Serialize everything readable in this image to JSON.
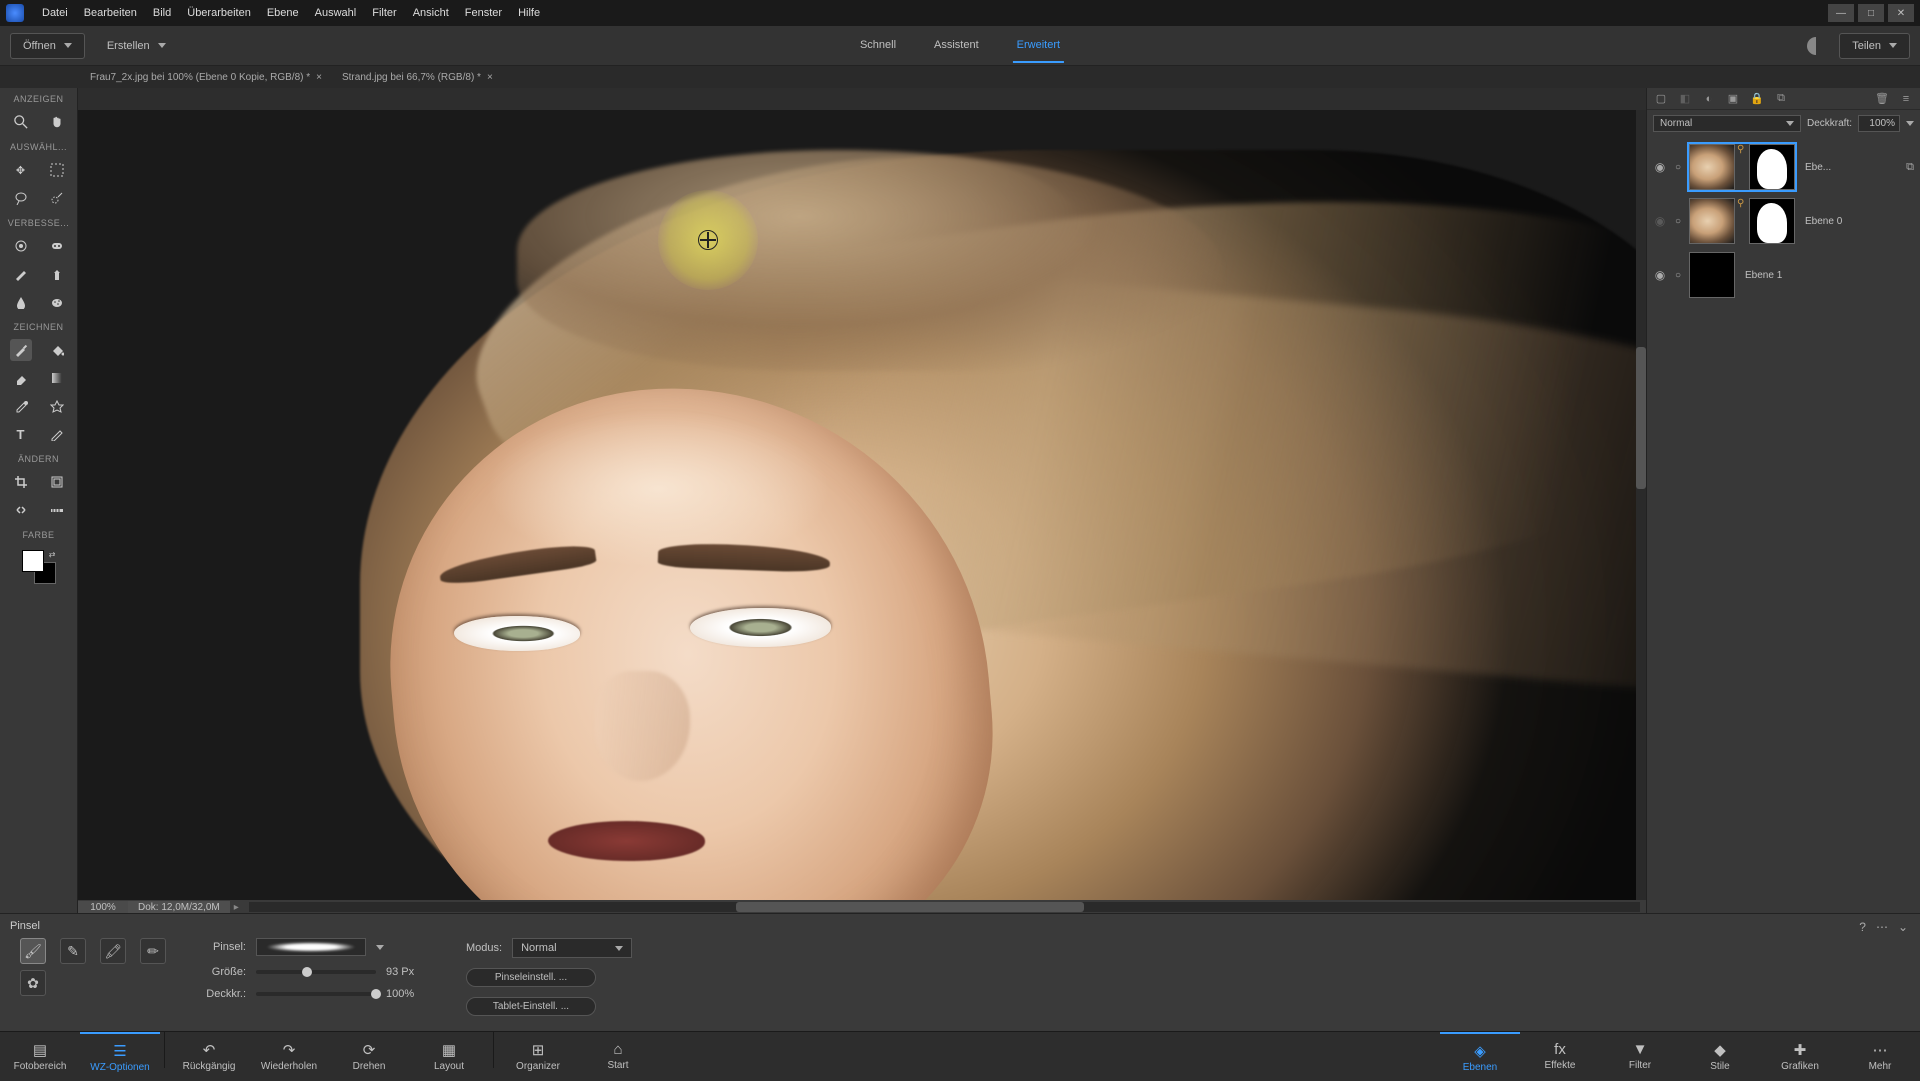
{
  "menu": [
    "Datei",
    "Bearbeiten",
    "Bild",
    "Überarbeiten",
    "Ebene",
    "Auswahl",
    "Filter",
    "Ansicht",
    "Fenster",
    "Hilfe"
  ],
  "topbar": {
    "open": "Öffnen",
    "create": "Erstellen",
    "modes": {
      "quick": "Schnell",
      "guided": "Assistent",
      "expert": "Erweitert"
    },
    "share": "Teilen"
  },
  "doctabs": [
    {
      "label": "Frau7_2x.jpg bei 100% (Ebene 0 Kopie, RGB/8) *"
    },
    {
      "label": "Strand.jpg bei 66,7% (RGB/8) *"
    }
  ],
  "toolbar": {
    "sections": {
      "view": "ANZEIGEN",
      "select": "AUSWÄHL...",
      "enhance": "VERBESSE...",
      "draw": "ZEICHNEN",
      "modify": "ÄNDERN",
      "color": "FARBE"
    }
  },
  "canvas_status": {
    "zoom": "100%",
    "docsize": "Dok: 12,0M/32,0M"
  },
  "layers_panel": {
    "blend": "Normal",
    "opacity_label": "Deckkraft:",
    "opacity_value": "100%",
    "layers": [
      {
        "name": "Ebe...",
        "has_mask": true,
        "visible": true,
        "selected": true
      },
      {
        "name": "Ebene 0",
        "has_mask": true,
        "visible": false,
        "selected": false
      },
      {
        "name": "Ebene 1",
        "has_mask": false,
        "visible": true,
        "selected": false,
        "black": true
      }
    ]
  },
  "tool_options": {
    "title": "Pinsel",
    "brush_label": "Pinsel:",
    "size_label": "Größe:",
    "size_value": "93 Px",
    "opacity_label": "Deckkr.:",
    "opacity_value": "100%",
    "mode_label": "Modus:",
    "mode_value": "Normal",
    "btn_brush_settings": "Pinseleinstell. ...",
    "btn_tablet_settings": "Tablet-Einstell. ..."
  },
  "bottombar_left": [
    {
      "label": "Fotobereich",
      "key": "photo-bin"
    },
    {
      "label": "WZ-Optionen",
      "key": "tool-options",
      "active": true
    },
    {
      "label": "Rückgängig",
      "key": "undo"
    },
    {
      "label": "Wiederholen",
      "key": "redo"
    },
    {
      "label": "Drehen",
      "key": "rotate"
    },
    {
      "label": "Layout",
      "key": "layout"
    },
    {
      "label": "Organizer",
      "key": "organizer"
    },
    {
      "label": "Start",
      "key": "home"
    }
  ],
  "bottombar_right": [
    {
      "label": "Ebenen",
      "key": "layers",
      "active": true
    },
    {
      "label": "Effekte",
      "key": "effects"
    },
    {
      "label": "Filter",
      "key": "filters"
    },
    {
      "label": "Stile",
      "key": "styles"
    },
    {
      "label": "Grafiken",
      "key": "graphics"
    },
    {
      "label": "Mehr",
      "key": "more"
    }
  ]
}
